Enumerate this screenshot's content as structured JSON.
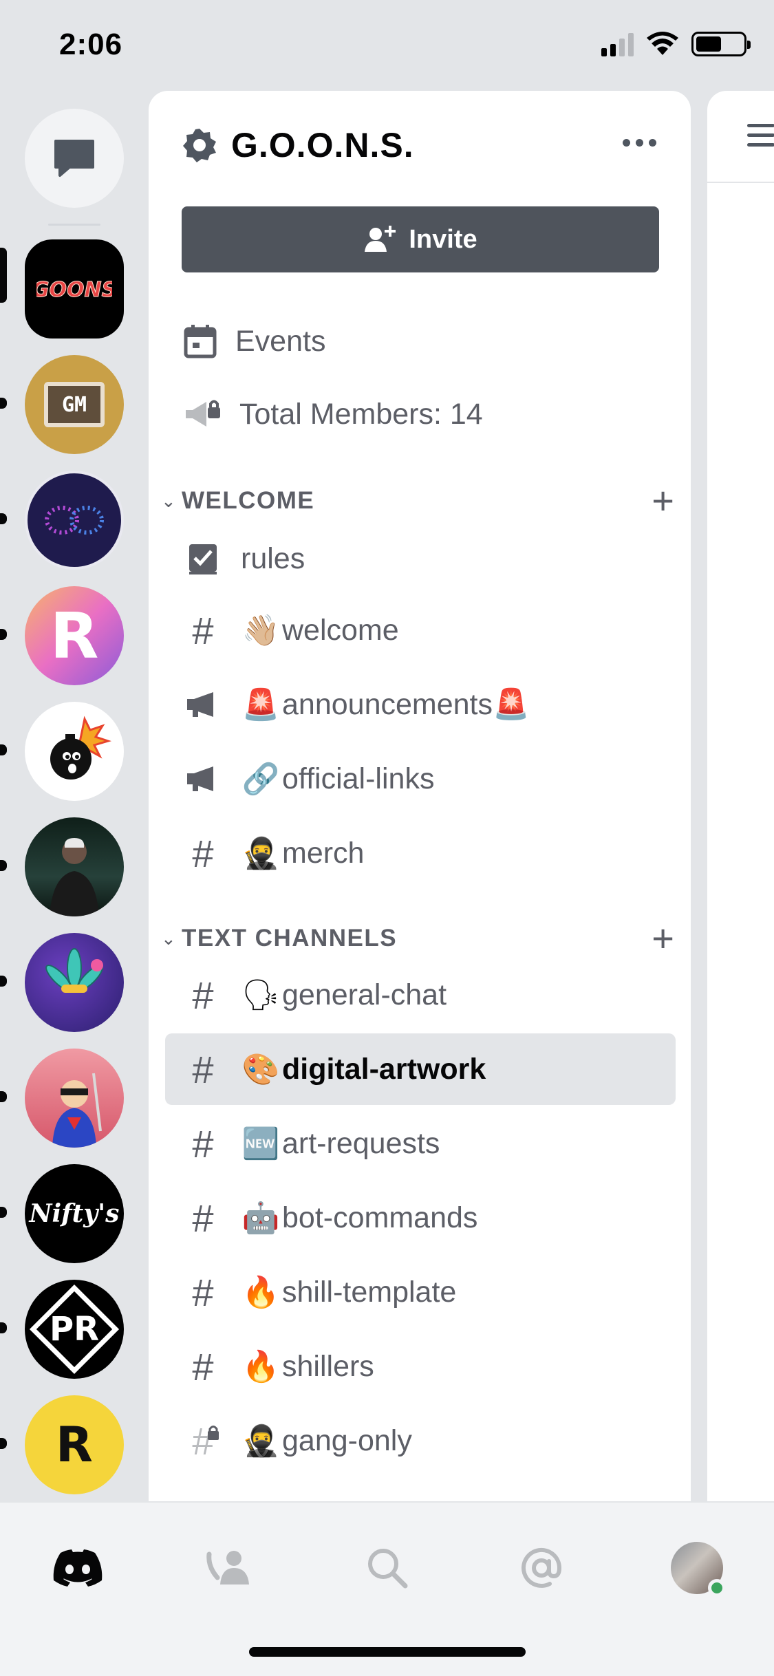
{
  "status_bar": {
    "time": "2:06",
    "signal_bars": 2,
    "battery_level": 0.55
  },
  "servers": [
    {
      "name": "direct-messages",
      "icon": "chat-bubble-icon"
    },
    {
      "name": "goons",
      "label": "GOONS",
      "active": true,
      "color": "#000000",
      "text_color": "#e84545"
    },
    {
      "name": "gm",
      "label": "GM",
      "color": "#c9a047"
    },
    {
      "name": "infinity",
      "color": "#1f1b4d"
    },
    {
      "name": "r-gradient",
      "label": "R",
      "color": "#e96fc4"
    },
    {
      "name": "bomb",
      "color": "#ffffff"
    },
    {
      "name": "matrix-man",
      "color": "#1d2a25"
    },
    {
      "name": "cannabis",
      "color": "#3b2b8f"
    },
    {
      "name": "hero",
      "color": "#e26d79"
    },
    {
      "name": "niftys",
      "label": "Nifty's",
      "color": "#000000"
    },
    {
      "name": "pr",
      "label": "PR",
      "color": "#000000"
    },
    {
      "name": "r-yellow",
      "label": "R",
      "color": "#f5d53b"
    }
  ],
  "server": {
    "name": "G.O.O.N.S."
  },
  "invite": {
    "label": "Invite"
  },
  "nav": {
    "events": "Events",
    "members": "Total Members: 14"
  },
  "categories": [
    {
      "name": "WELCOME",
      "channels": [
        {
          "icon": "rules",
          "emoji": "",
          "name": "rules"
        },
        {
          "icon": "hash",
          "emoji": "👋🏼",
          "name": "welcome"
        },
        {
          "icon": "megaphone",
          "emoji": "🚨",
          "name": "announcements🚨"
        },
        {
          "icon": "megaphone",
          "emoji": "🔗",
          "name": "official-links"
        },
        {
          "icon": "hash",
          "emoji": "🥷",
          "name": "merch"
        }
      ]
    },
    {
      "name": "TEXT CHANNELS",
      "channels": [
        {
          "icon": "hash",
          "emoji": "🗣",
          "name": "general-chat"
        },
        {
          "icon": "hash",
          "emoji": "🎨",
          "name": "digital-artwork",
          "selected": true
        },
        {
          "icon": "hash",
          "emoji": "🆕",
          "name": "art-requests"
        },
        {
          "icon": "hash",
          "emoji": "🤖",
          "name": "bot-commands"
        },
        {
          "icon": "hash",
          "emoji": "🔥",
          "name": "shill-template"
        },
        {
          "icon": "hash",
          "emoji": "🔥",
          "name": "shillers"
        },
        {
          "icon": "hash-locked",
          "emoji": "🥷",
          "name": "gang-only"
        }
      ]
    }
  ],
  "tabs": [
    {
      "name": "home",
      "icon": "discord-logo-icon",
      "active": true
    },
    {
      "name": "friends",
      "icon": "friends-icon"
    },
    {
      "name": "search",
      "icon": "search-icon"
    },
    {
      "name": "mentions",
      "icon": "at-icon"
    },
    {
      "name": "profile",
      "icon": "avatar-icon",
      "status": "online"
    }
  ],
  "colors": {
    "background": "#e3e5e8",
    "panel": "#ffffff",
    "invite_button": "#4f545c",
    "muted_text": "#5c5e66",
    "selected_row": "#e3e5e8",
    "online": "#3ba55d"
  }
}
